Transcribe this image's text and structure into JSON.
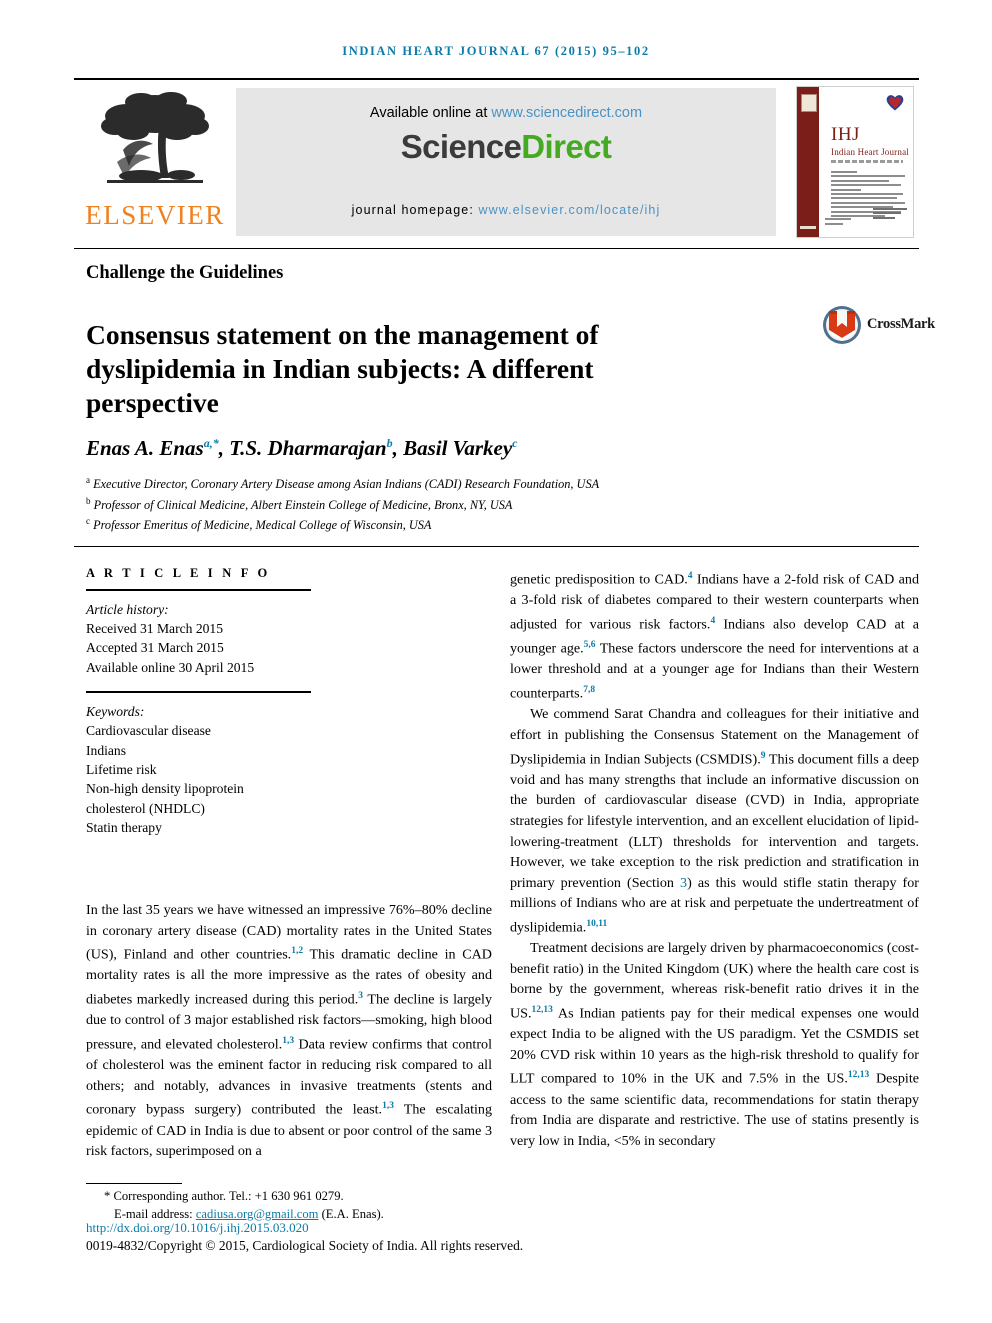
{
  "running_head": "INDIAN HEART JOURNAL 67 (2015) 95–102",
  "masthead": {
    "publisher_logo_label": "ELSEVIER",
    "available_online_prefix": "Available online at ",
    "available_online_url": "www.sciencedirect.com",
    "sciencedirect_logo": {
      "part1": "Science",
      "part2": "Direct"
    },
    "journal_homepage_prefix": "journal homepage: ",
    "journal_homepage_url": "www.elsevier.com/locate/ihj",
    "cover": {
      "abbrev": "IHJ",
      "title": "Indian Heart Journal"
    }
  },
  "section_label": "Challenge the Guidelines",
  "title": "Consensus statement on the management of dyslipidemia in Indian subjects: A different perspective",
  "crossmark": {
    "label": "CrossMark"
  },
  "authors": {
    "a1_name": "Enas A. Enas",
    "a1_marks": "a,*",
    "a2_name": "T.S. Dharmarajan",
    "a2_marks": "b",
    "a3_name": "Basil Varkey",
    "a3_marks": "c",
    "affiliations": [
      {
        "mark": "a",
        "text": "Executive Director, Coronary Artery Disease among Asian Indians (CADI) Research Foundation, USA"
      },
      {
        "mark": "b",
        "text": "Professor of Clinical Medicine, Albert Einstein College of Medicine, Bronx, NY, USA"
      },
      {
        "mark": "c",
        "text": "Professor Emeritus of Medicine, Medical College of Wisconsin, USA"
      }
    ]
  },
  "article_info": {
    "heading": "A R T I C L E   I N F O",
    "history_label": "Article history:",
    "history": [
      "Received 31 March 2015",
      "Accepted 31 March 2015",
      "Available online 30 April 2015"
    ],
    "keywords_label": "Keywords:",
    "keywords": [
      "Cardiovascular disease",
      "Indians",
      "Lifetime risk",
      "Non-high density lipoprotein",
      "cholesterol (NHDLC)",
      "Statin therapy"
    ]
  },
  "left_column_body": {
    "paragraph_1_parts": [
      {
        "t": "In the last 35 years we have witnessed an impressive 76%–80% decline in coronary artery disease (CAD) mortality rates in the United States (US), Finland and other countries."
      },
      {
        "sup": "1,2"
      },
      {
        "t": " This dramatic decline in CAD mortality rates is all the more impressive as the rates of obesity and diabetes markedly increased during this period."
      },
      {
        "sup": "3"
      },
      {
        "t": " The decline is largely due to control of 3 major established risk factors—smoking, high blood pressure, and elevated cholesterol."
      },
      {
        "sup": "1,3"
      },
      {
        "t": " Data review confirms that control of cholesterol was the eminent factor in reducing risk compared to all others; and notably, advances in invasive treatments (stents and coronary bypass surgery) contributed the least."
      },
      {
        "sup": "1,3"
      },
      {
        "t": " The escalating epidemic of CAD in India is due to absent or poor control of the same 3 risk factors, superimposed on a"
      }
    ]
  },
  "right_column_body": {
    "paragraph_1_parts": [
      {
        "t": "genetic predisposition to CAD."
      },
      {
        "sup": "4"
      },
      {
        "t": " Indians have a 2-fold risk of CAD and a 3-fold risk of diabetes compared to their western counterparts when adjusted for various risk factors."
      },
      {
        "sup": "4"
      },
      {
        "t": " Indians also develop CAD at a younger age."
      },
      {
        "sup": "5,6"
      },
      {
        "t": " These factors underscore the need for interventions at a lower threshold and at a younger age for Indians than their Western counterparts."
      },
      {
        "sup": "7,8"
      }
    ],
    "paragraph_2_parts": [
      {
        "t": "We commend Sarat Chandra and colleagues for their initiative and effort in publishing the Consensus Statement on the Management of Dyslipidemia in Indian Subjects (CSMDIS)."
      },
      {
        "sup": "9"
      },
      {
        "t": " This document fills a deep void and has many strengths that include an informative discussion on the burden of cardiovascular disease (CVD) in India, appropriate strategies for lifestyle intervention, and an excellent elucidation of lipid-lowering-treatment (LLT) thresholds for intervention and targets. However, we take exception to the risk prediction and stratification in primary prevention (Section "
      },
      {
        "lnk": "3"
      },
      {
        "t": ") as this would stifle statin therapy for millions of Indians who are at risk and perpetuate the undertreatment of dyslipidemia."
      },
      {
        "sup": "10,11"
      }
    ],
    "paragraph_3_parts": [
      {
        "t": "Treatment decisions are largely driven by pharmacoeconomics (cost-benefit ratio) in the United Kingdom (UK) where the health care cost is borne by the government, whereas risk-benefit ratio drives it in the US."
      },
      {
        "sup": "12,13"
      },
      {
        "t": " As Indian patients pay for their medical expenses one would expect India to be aligned with the US paradigm. Yet the CSMDIS set 20% CVD risk within 10 years as the high-risk threshold to qualify for LLT compared to 10% in the UK and 7.5% in the US."
      },
      {
        "sup": "12,13"
      },
      {
        "t": " Despite access to the same scientific data, recommendations for statin therapy from India are disparate and restrictive. The use of statins presently is very low in India, <5% in secondary"
      }
    ]
  },
  "footer": {
    "corresponding_author": "Corresponding author. Tel.: +1 630 961 0279.",
    "email_label": "E-mail address: ",
    "email": "cadiusa.org@gmail.com",
    "email_suffix": " (E.A. Enas).",
    "doi": "http://dx.doi.org/10.1016/j.ihj.2015.03.020",
    "copyright": "0019-4832/Copyright © 2015, Cardiological Society of India. All rights reserved."
  },
  "colors": {
    "accent_teal": "#0b7ba8",
    "elsevier_orange": "#f08121",
    "sciencedirect_green": "#44aa22",
    "link_blue": "#4a93c4",
    "cover_maroon": "#7b1d18",
    "panel_gray": "#e6e6e6"
  }
}
